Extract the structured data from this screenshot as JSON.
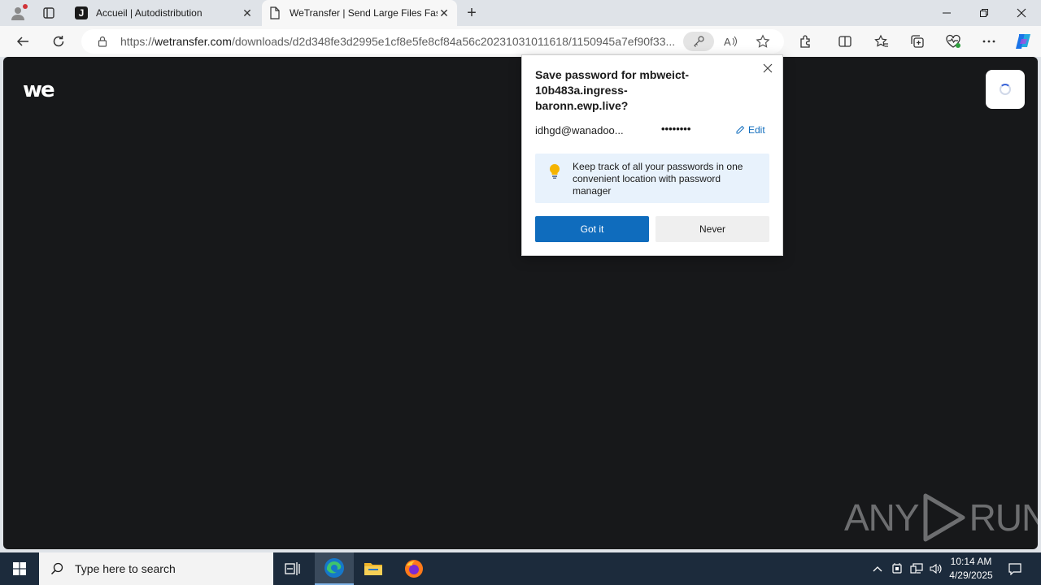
{
  "tabs": [
    {
      "title": "Accueil | Autodistribution",
      "favicon_letter": "J"
    },
    {
      "title": "WeTransfer | Send Large Files Fast"
    }
  ],
  "address": {
    "scheme": "https://",
    "host": "wetransfer.com",
    "path": "/downloads/d2d348fe3d2995e1cf8e5fe8cf84a56c20231031011618/1150945a7ef90f33..."
  },
  "page": {
    "logo": "we"
  },
  "password_popup": {
    "title": "Save password for mbweict-10b483a.ingress-baronn.ewp.live?",
    "username": "idhgd@wanadoo...",
    "password_mask": "••••••••",
    "edit_label": "Edit",
    "tip_text": "Keep track of all your passwords in one convenient location with password manager",
    "got_it_label": "Got it",
    "never_label": "Never"
  },
  "watermark": {
    "text_left": "ANY",
    "text_right": "RUN"
  },
  "taskbar": {
    "search_placeholder": "Type here to search",
    "time": "10:14 AM",
    "date": "4/29/2025"
  },
  "colors": {
    "accent": "#0f6cbd",
    "page_bg": "#17181a",
    "taskbar_bg": "#1c2b3c"
  }
}
